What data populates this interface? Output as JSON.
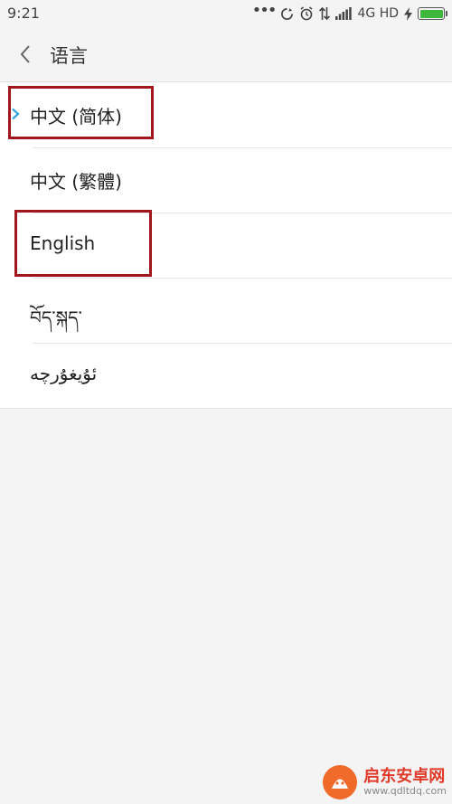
{
  "status_bar": {
    "time": "9:21",
    "network": "4G HD",
    "battery_level": 1.0,
    "icons": [
      "more-dots-icon",
      "sync-icon",
      "alarm-icon",
      "data-transfer-icon",
      "signal-icon",
      "charging-icon",
      "battery-icon"
    ]
  },
  "header": {
    "back_icon": "chevron-left-icon",
    "title": "语言"
  },
  "languages": [
    {
      "label": "中文 (简体)",
      "selected": true
    },
    {
      "label": "中文 (繁體)",
      "selected": false
    },
    {
      "label": "English",
      "selected": false
    },
    {
      "label": "བོད་སྐད་",
      "selected": false
    },
    {
      "label": "ئۇيغۇرچە",
      "selected": false
    }
  ],
  "colors": {
    "accent": "#2aa3d8",
    "annotation": "#a0161c",
    "battery": "#3db83d"
  },
  "watermark": {
    "title": "启东安卓网",
    "url": "www.qdltdq.com"
  }
}
